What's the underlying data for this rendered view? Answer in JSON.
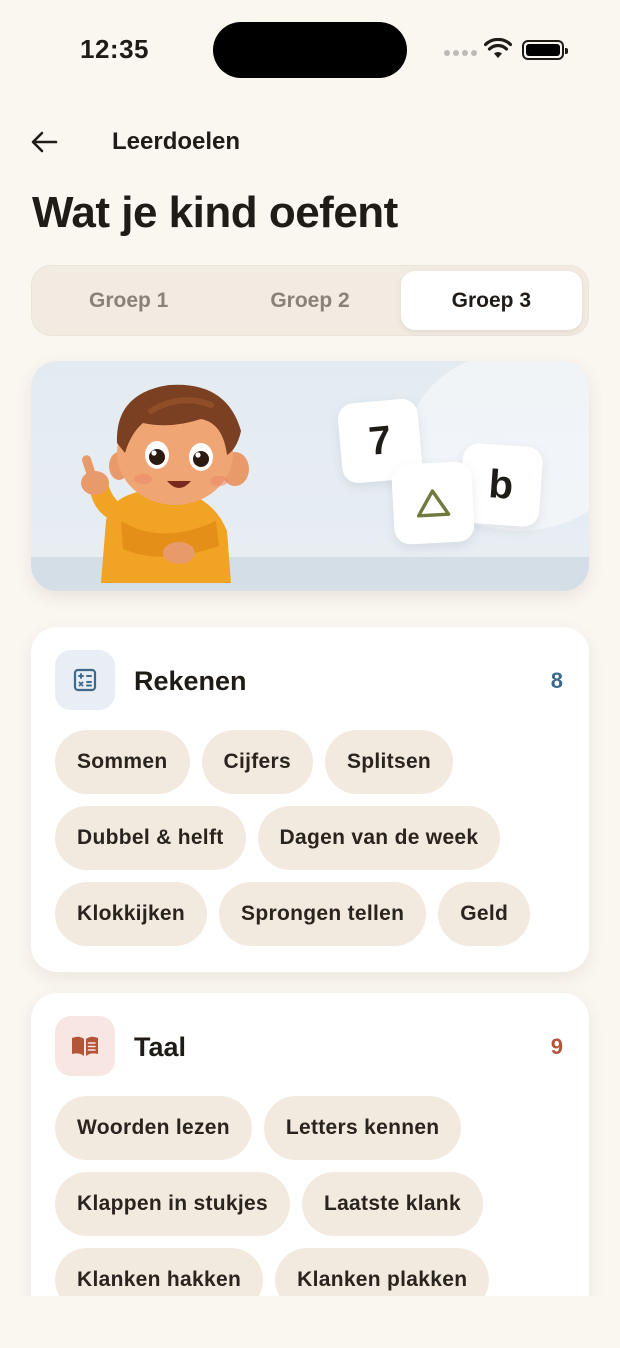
{
  "status_bar": {
    "time": "12:35"
  },
  "nav": {
    "back_icon": "arrow-left-icon",
    "title": "Leerdoelen"
  },
  "page": {
    "title": "Wat je kind oefent"
  },
  "segments": {
    "items": [
      "Groep 1",
      "Groep 2",
      "Groep 3"
    ],
    "selected": "Groep 3"
  },
  "hero": {
    "tiles": [
      "7",
      "b"
    ],
    "triangle_color": "#6f7a3c"
  },
  "categories": [
    {
      "name": "Rekenen",
      "icon": "calculator-icon",
      "count": "8",
      "accent": "#3d6a8c",
      "chips": [
        "Sommen",
        "Cijfers",
        "Splitsen",
        "Dubbel & helft",
        "Dagen van de week",
        "Klokkijken",
        "Sprongen tellen",
        "Geld"
      ]
    },
    {
      "name": "Taal",
      "icon": "open-book-icon",
      "count": "9",
      "accent": "#b4553b",
      "chips": [
        "Woorden lezen",
        "Letters kennen",
        "Klappen in stukjes",
        "Laatste klank",
        "Klanken hakken",
        "Klanken plakken"
      ]
    }
  ]
}
